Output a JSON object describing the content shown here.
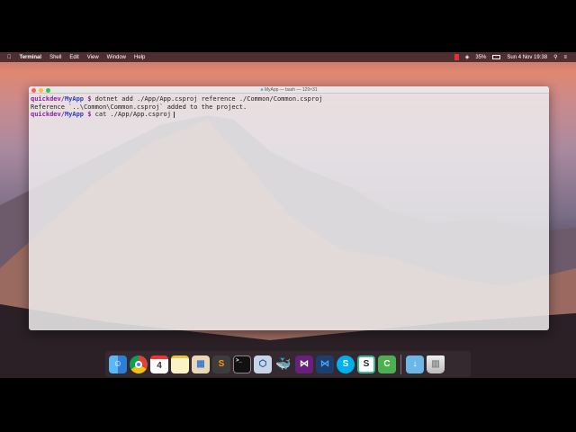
{
  "menubar": {
    "app": "Terminal",
    "items": [
      "Shell",
      "Edit",
      "View",
      "Window",
      "Help"
    ],
    "battery": "35%",
    "datetime": "Sun 4 Nov  19:38"
  },
  "terminal": {
    "title": "MyApp — bash — 129×31",
    "lines": [
      {
        "prompt_user": "quickdev/",
        "prompt_dir": "MyApp",
        "prompt_sym": " $ ",
        "text": "dotnet add ./App/App.csproj reference ./Common/Common.csproj"
      },
      {
        "text": "Reference `..\\Common\\Common.csproj` added to the project."
      },
      {
        "prompt_user": "quickdev/",
        "prompt_dir": "MyApp",
        "prompt_sym": " $ ",
        "text": "cat ./App/App.csproj"
      }
    ]
  },
  "dock": [
    "Finder",
    "Chrome",
    "Calendar",
    "Notes",
    "Preview",
    "Sublime Text",
    "Terminal",
    "VirtualBox",
    "Docker",
    "Visual Studio",
    "VS Code",
    "Skype",
    "Slack",
    "Camtasia",
    "Downloads",
    "Trash"
  ],
  "calendar_day": "4"
}
